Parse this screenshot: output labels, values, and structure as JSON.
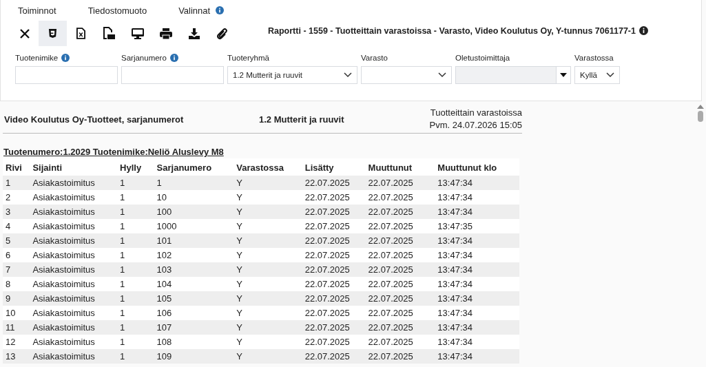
{
  "menu": [
    {
      "label": "Toiminnot",
      "info": false
    },
    {
      "label": "Tiedostomuoto",
      "info": false
    },
    {
      "label": "Valinnat",
      "info": true
    }
  ],
  "toolbar": [
    {
      "kind": "close",
      "selected": false
    },
    {
      "kind": "html",
      "selected": true
    },
    {
      "kind": "excel",
      "selected": false
    },
    {
      "kind": "pdf",
      "selected": false
    },
    {
      "kind": "screen",
      "selected": false
    },
    {
      "kind": "print",
      "selected": false
    },
    {
      "kind": "download",
      "selected": false
    },
    {
      "kind": "attach",
      "selected": false
    }
  ],
  "report_title": "Raportti - 1559 - Tuotteittain varastoissa - Varasto, Video Koulutus Oy, Y-tunnus 7061177-1",
  "filters": [
    {
      "kind": "text",
      "label": "Tuotenimike",
      "info": true
    },
    {
      "kind": "text",
      "label": "Sarjanumero",
      "info": true
    },
    {
      "kind": "select",
      "label": "Tuoteryhmä",
      "info": false,
      "value": "1.2 Mutterit ja ruuvit"
    },
    {
      "kind": "select",
      "label": "Varasto",
      "info": false
    },
    {
      "kind": "combo",
      "label": "Oletustoimittaja",
      "info": false,
      "disabled": true
    },
    {
      "kind": "select",
      "label": "Varastossa",
      "info": false,
      "value": "Kyllä"
    }
  ],
  "report": {
    "company": "Video Koulutus Oy-Tuotteet, sarjanumerot",
    "group": "1.2 Mutterit ja ruuvit",
    "name": "Tuotteittain varastoissa",
    "date": "Pvm. 24.07.2026 15:05",
    "product": "Tuotenumero:1.2029 Tuotenimike:Neliö Aluslevy M8",
    "columns": [
      "Rivi",
      "Sijainti",
      "Hylly",
      "Sarjanumero",
      "Varastossa",
      "Lisätty",
      "Muuttunut",
      "Muuttunut klo"
    ],
    "rows": [
      [
        "1",
        "Asiakastoimitus",
        "1",
        "1",
        "Y",
        "22.07.2025",
        "22.07.2025",
        "13:47:34"
      ],
      [
        "2",
        "Asiakastoimitus",
        "1",
        "10",
        "Y",
        "22.07.2025",
        "22.07.2025",
        "13:47:34"
      ],
      [
        "3",
        "Asiakastoimitus",
        "1",
        "100",
        "Y",
        "22.07.2025",
        "22.07.2025",
        "13:47:34"
      ],
      [
        "4",
        "Asiakastoimitus",
        "1",
        "1000",
        "Y",
        "22.07.2025",
        "22.07.2025",
        "13:47:35"
      ],
      [
        "5",
        "Asiakastoimitus",
        "1",
        "101",
        "Y",
        "22.07.2025",
        "22.07.2025",
        "13:47:34"
      ],
      [
        "6",
        "Asiakastoimitus",
        "1",
        "102",
        "Y",
        "22.07.2025",
        "22.07.2025",
        "13:47:34"
      ],
      [
        "7",
        "Asiakastoimitus",
        "1",
        "103",
        "Y",
        "22.07.2025",
        "22.07.2025",
        "13:47:34"
      ],
      [
        "8",
        "Asiakastoimitus",
        "1",
        "104",
        "Y",
        "22.07.2025",
        "22.07.2025",
        "13:47:34"
      ],
      [
        "9",
        "Asiakastoimitus",
        "1",
        "105",
        "Y",
        "22.07.2025",
        "22.07.2025",
        "13:47:34"
      ],
      [
        "10",
        "Asiakastoimitus",
        "1",
        "106",
        "Y",
        "22.07.2025",
        "22.07.2025",
        "13:47:34"
      ],
      [
        "11",
        "Asiakastoimitus",
        "1",
        "107",
        "Y",
        "22.07.2025",
        "22.07.2025",
        "13:47:34"
      ],
      [
        "12",
        "Asiakastoimitus",
        "1",
        "108",
        "Y",
        "22.07.2025",
        "22.07.2025",
        "13:47:34"
      ],
      [
        "13",
        "Asiakastoimitus",
        "1",
        "109",
        "Y",
        "22.07.2025",
        "22.07.2025",
        "13:47:34"
      ]
    ]
  }
}
